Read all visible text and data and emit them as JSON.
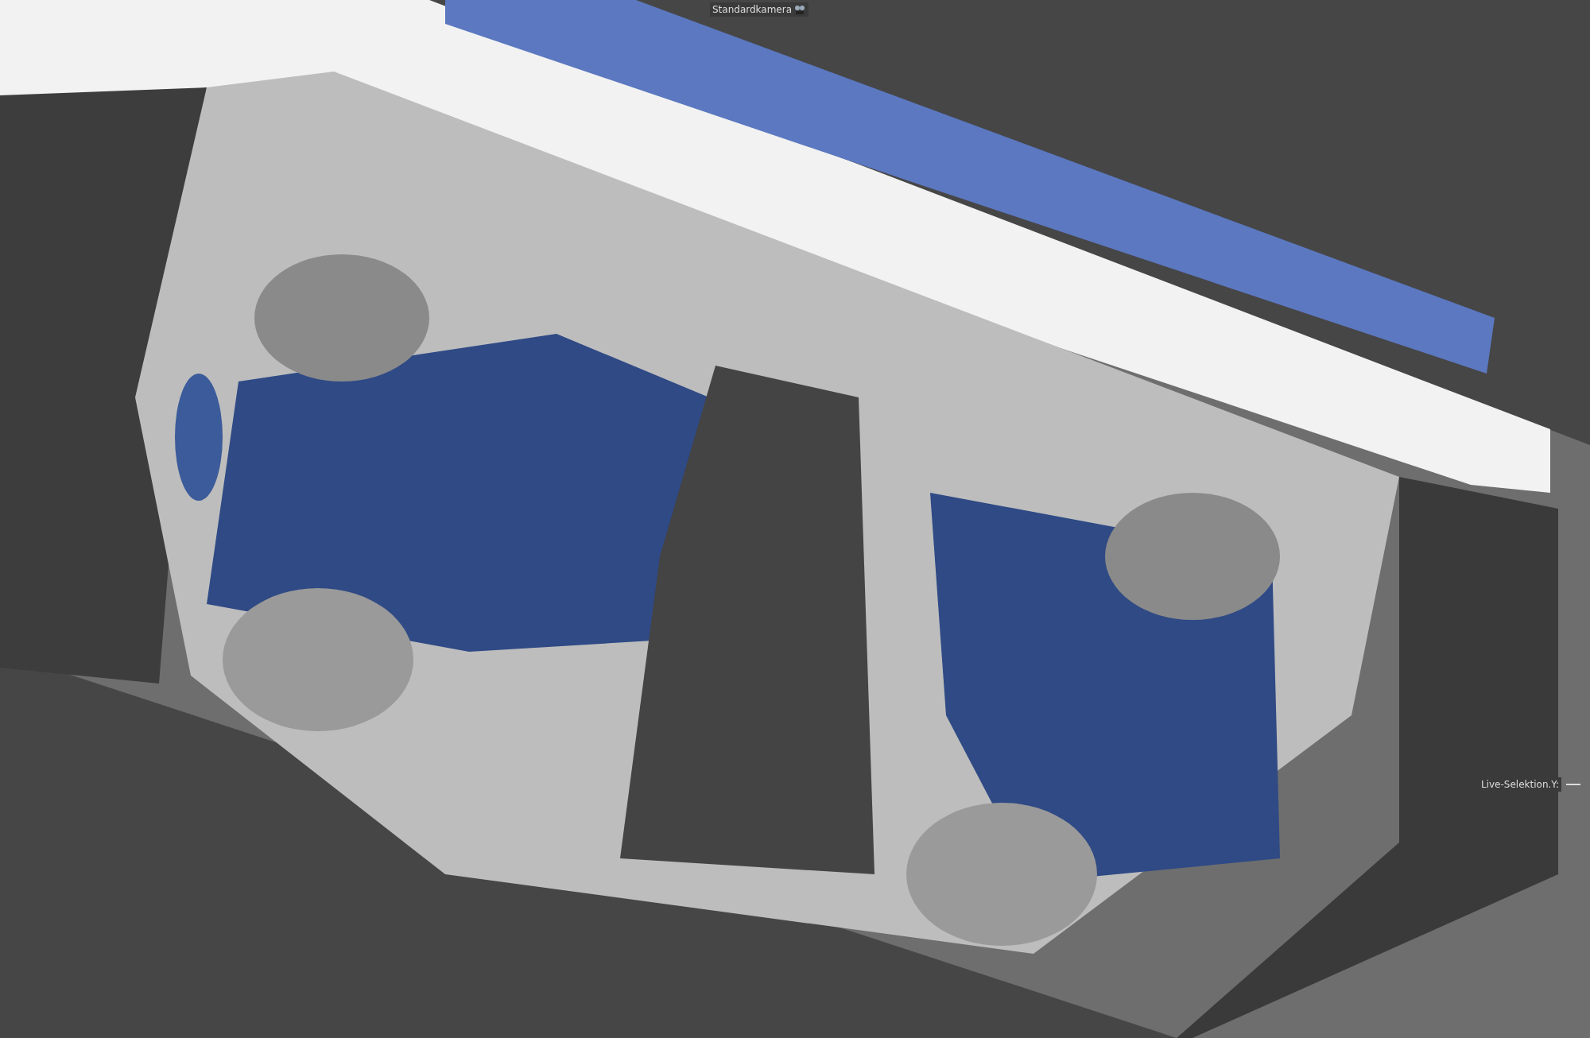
{
  "viewport": {
    "camera_label": "Standardkamera",
    "hud_label": "Live-Selektion.Y:"
  }
}
